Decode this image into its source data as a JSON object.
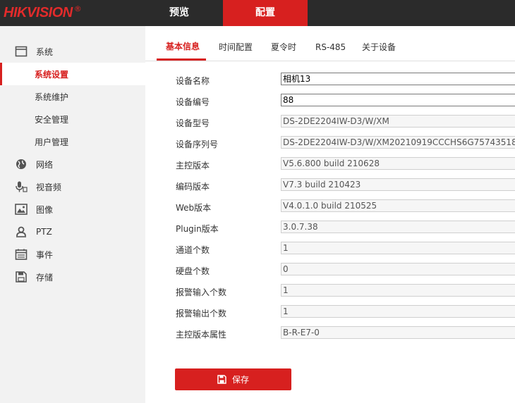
{
  "brand": {
    "name": "HIKVISION",
    "reg_mark": "®",
    "color": "#d7201f"
  },
  "top_nav": {
    "preview": "预览",
    "config": "配置"
  },
  "sidebar": {
    "items": [
      {
        "label": "系统",
        "icon": "system-window-icon"
      },
      {
        "label": "系统设置",
        "active": true
      },
      {
        "label": "系统维护"
      },
      {
        "label": "安全管理"
      },
      {
        "label": "用户管理"
      },
      {
        "label": "网络",
        "icon": "network-globe-icon"
      },
      {
        "label": "视音频",
        "icon": "microphone-icon"
      },
      {
        "label": "图像",
        "icon": "image-icon"
      },
      {
        "label": "PTZ",
        "icon": "ptz-person-icon"
      },
      {
        "label": "事件",
        "icon": "event-calendar-icon"
      },
      {
        "label": "存储",
        "icon": "storage-save-icon"
      }
    ]
  },
  "tabs": [
    "基本信息",
    "时间配置",
    "夏令时",
    "RS-485",
    "关于设备"
  ],
  "form": {
    "rows": [
      {
        "label": "设备名称",
        "value": "相机13"
      },
      {
        "label": "设备编号",
        "value": "88"
      },
      {
        "label": "设备型号",
        "value": "DS-2DE2204IW-D3/W/XM"
      },
      {
        "label": "设备序列号",
        "value": "DS-2DE2204IW-D3/W/XM20210919CCCHS6G75743518"
      },
      {
        "label": "主控版本",
        "value": "V5.6.800 build 210628"
      },
      {
        "label": "编码版本",
        "value": "V7.3 build 210423"
      },
      {
        "label": "Web版本",
        "value": "V4.0.1.0 build 210525"
      },
      {
        "label": "Plugin版本",
        "value": "3.0.7.38"
      },
      {
        "label": "通道个数",
        "value": "1"
      },
      {
        "label": "硬盘个数",
        "value": "0"
      },
      {
        "label": "报警输入个数",
        "value": "1"
      },
      {
        "label": "报警输出个数",
        "value": "1"
      },
      {
        "label": "主控版本属性",
        "value": "B-R-E7-0"
      }
    ]
  },
  "save_button": {
    "label": "保存",
    "icon": "save-floppy-icon"
  }
}
